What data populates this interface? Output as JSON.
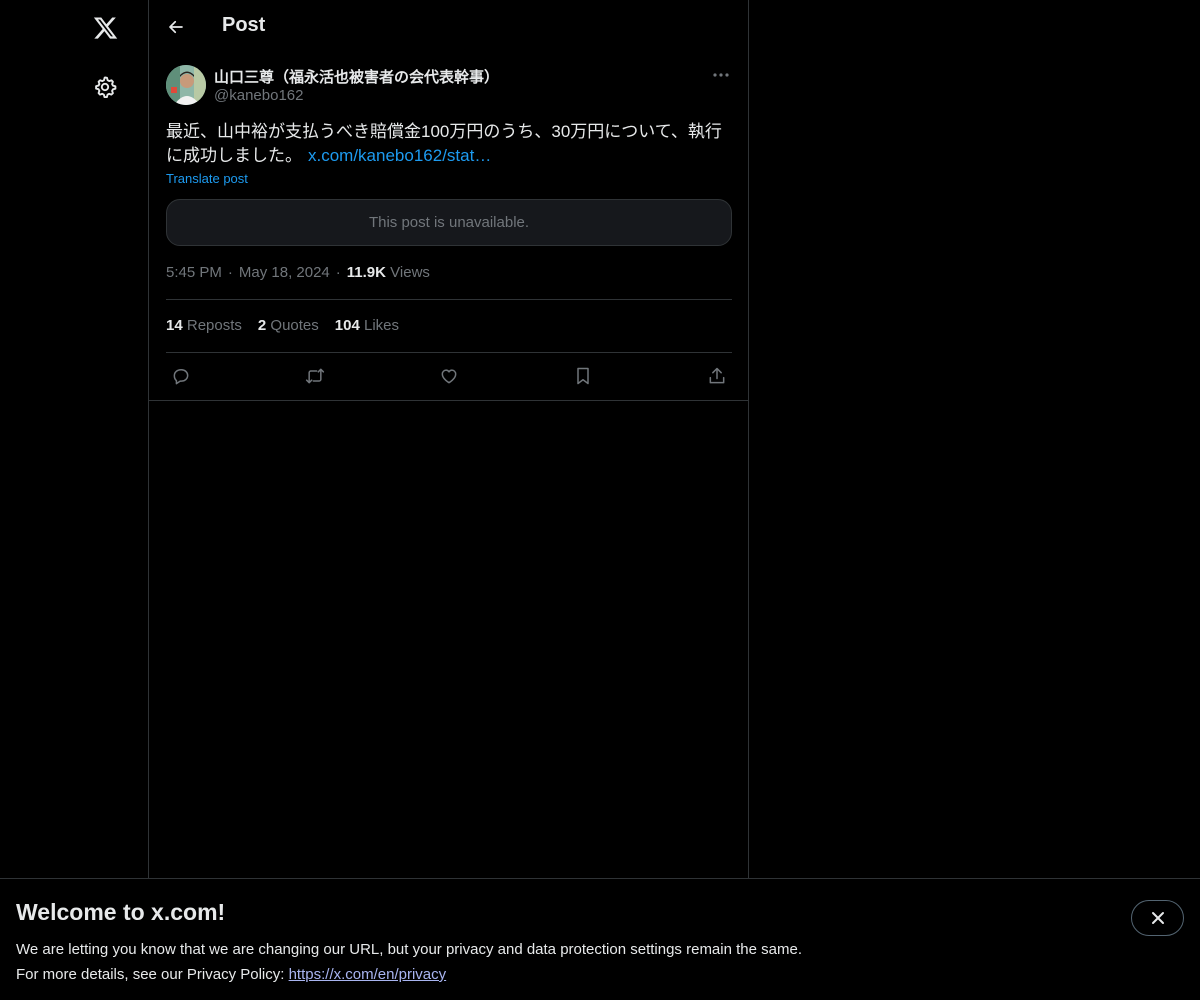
{
  "nav": {
    "logo_icon": "x-logo-icon",
    "settings_icon": "gear-icon"
  },
  "header": {
    "back_icon": "arrow-left-icon",
    "title": "Post"
  },
  "post": {
    "author_name": "山口三尊（福永活也被害者の会代表幹事）",
    "author_handle": "@kanebo162",
    "text": "最近、山中裕が支払うべき賠償金100万円のうち、30万円について、執行に成功しました。",
    "link_text": "x.com/kanebo162/stat…",
    "translate_label": "Translate post",
    "quoted_unavailable": "This post is unavailable.",
    "time": "5:45 PM",
    "date": "May 18, 2024",
    "views_count": "11.9K",
    "views_label": "Views",
    "reposts_count": "14",
    "reposts_label": "Reposts",
    "quotes_count": "2",
    "quotes_label": "Quotes",
    "likes_count": "104",
    "likes_label": "Likes"
  },
  "banner": {
    "title": "Welcome to x.com!",
    "line1": "We are letting you know that we are changing our URL, but your privacy and data protection settings remain the same.",
    "line2_prefix": "For more details, see our Privacy Policy: ",
    "privacy_link": "https://x.com/en/privacy"
  },
  "colors": {
    "background": "#000000",
    "text": "#e7e9ea",
    "secondary": "#71767b",
    "accent": "#1d9bf0",
    "border": "#2f3336"
  }
}
